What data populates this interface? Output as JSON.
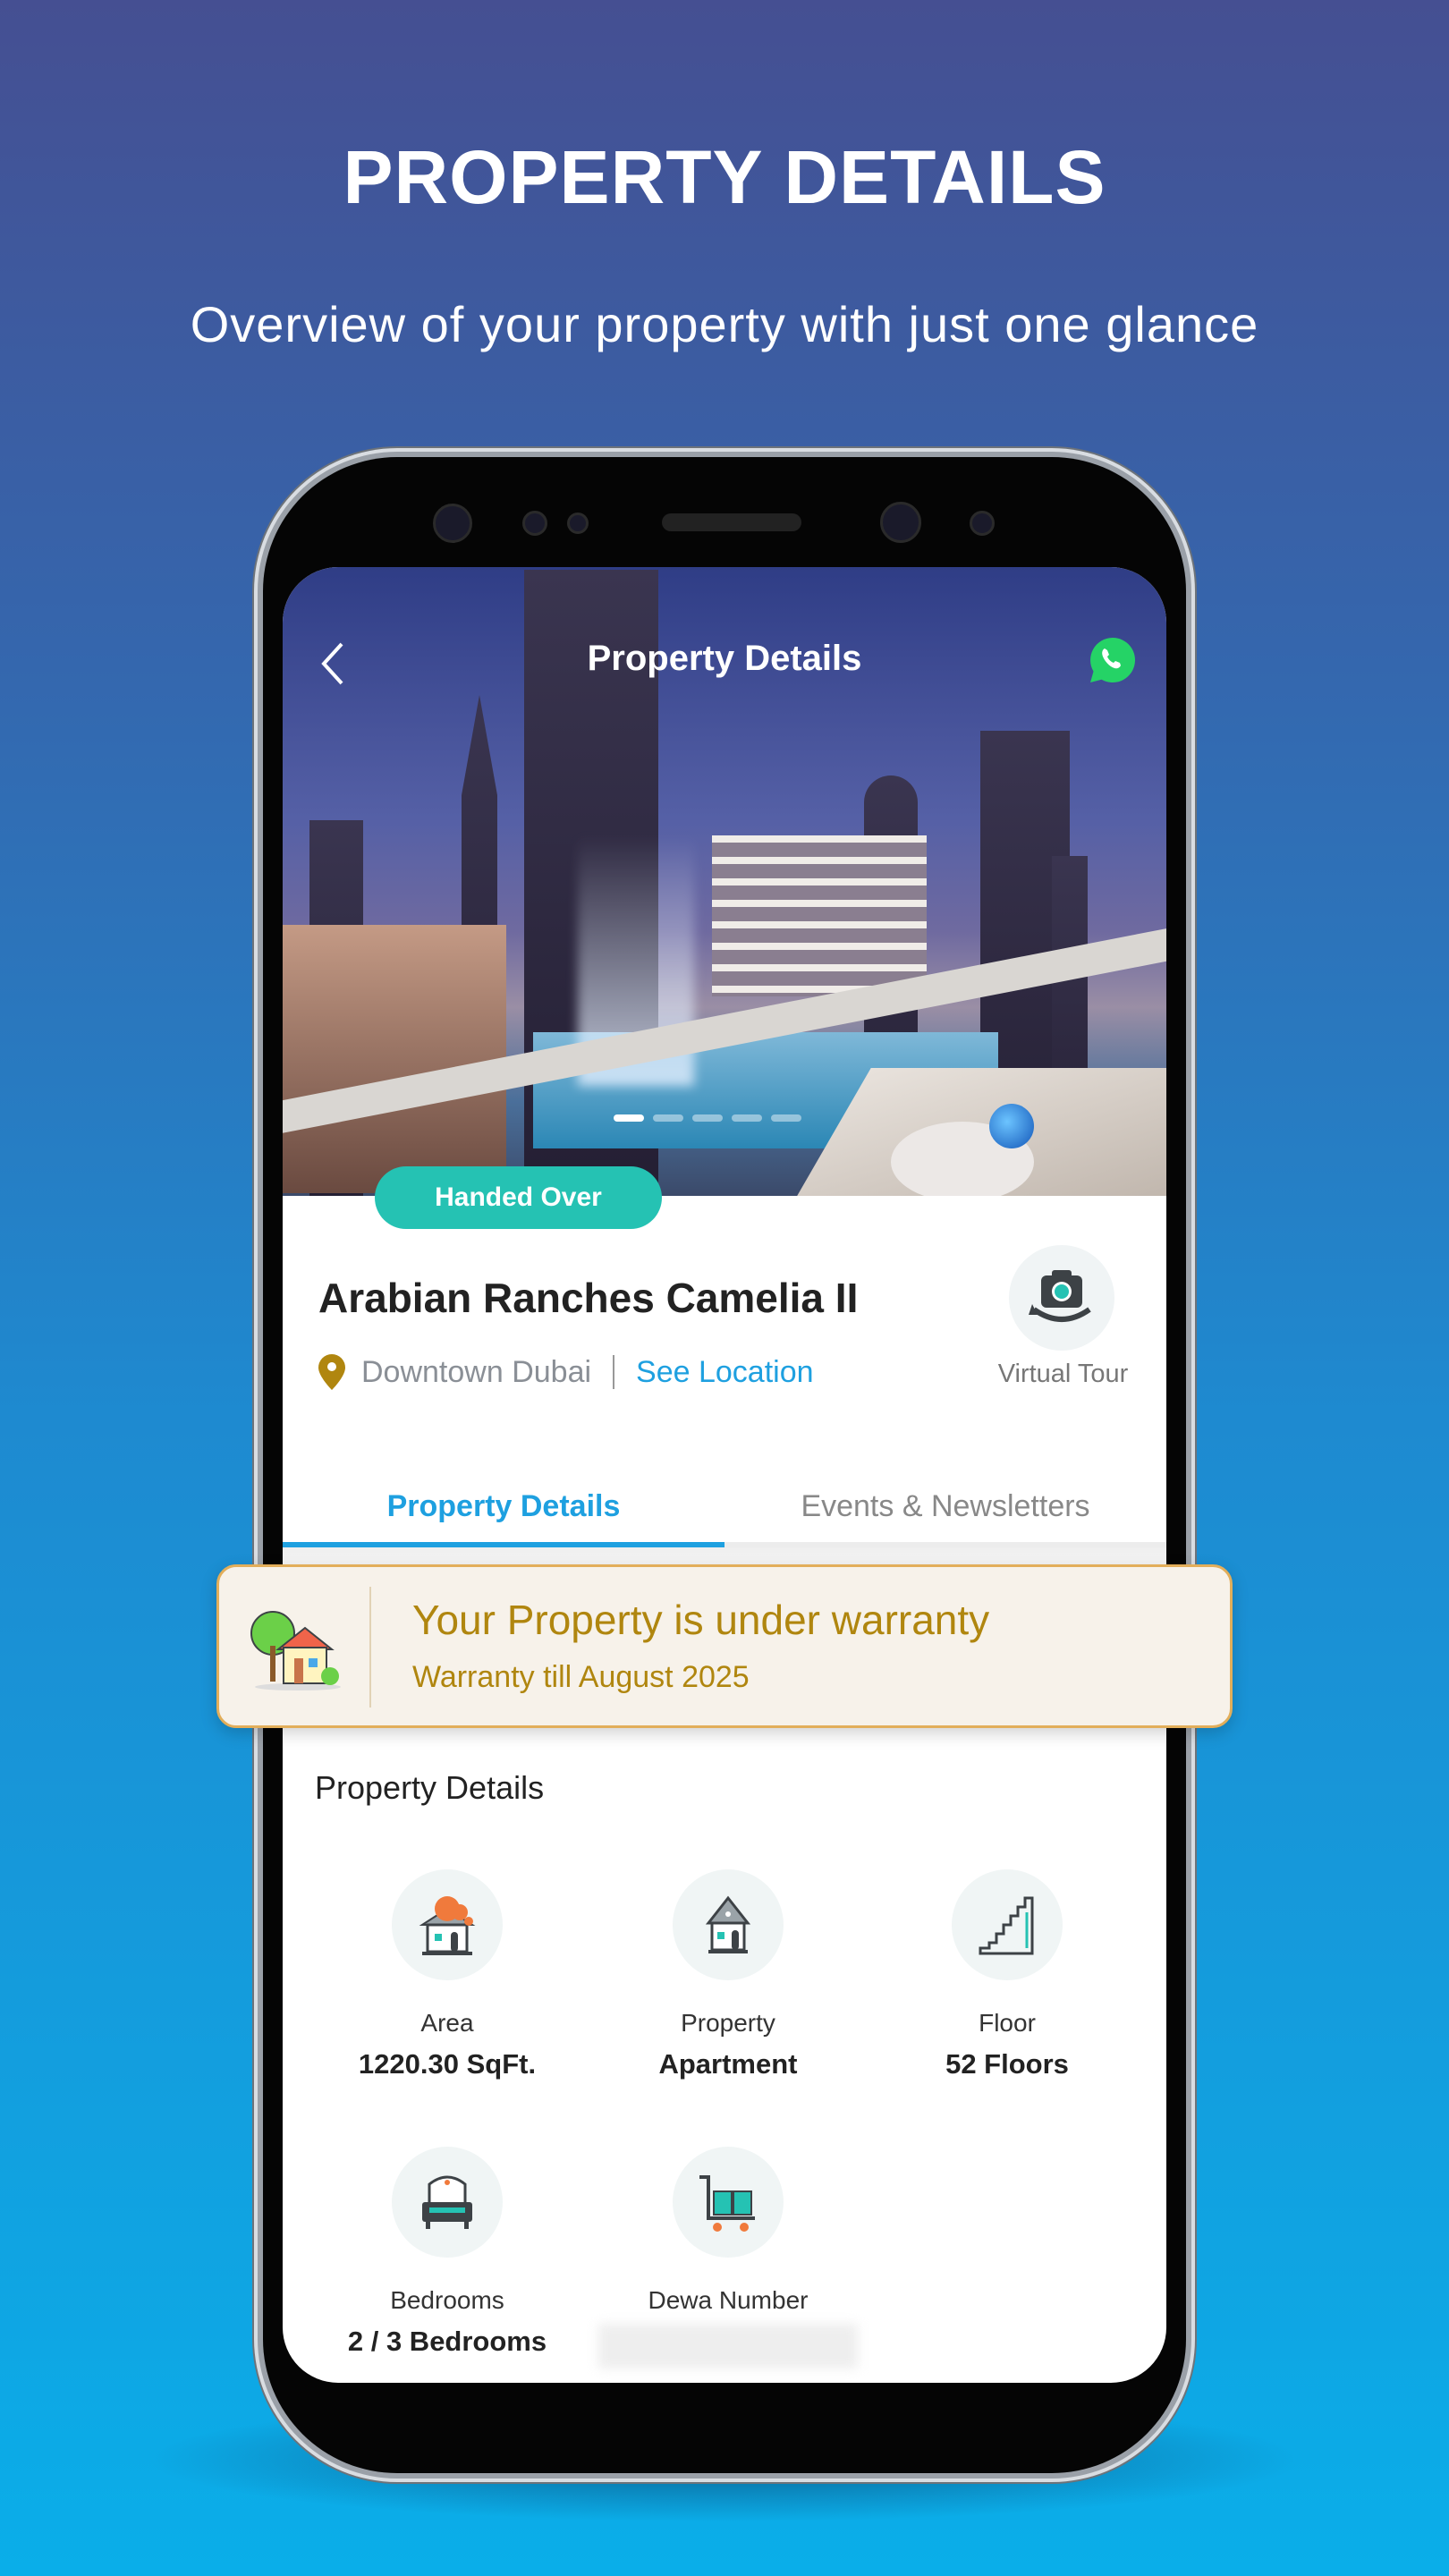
{
  "hero": {
    "title": "PROPERTY DETAILS",
    "subtitle": "Overview of your property with just one glance"
  },
  "app": {
    "header": {
      "title": "Property Details",
      "back_icon": "chevron-left-icon",
      "whatsapp_icon": "whatsapp-icon"
    },
    "carousel": {
      "slides": 5,
      "active": 0
    },
    "status_badge": "Handed Over",
    "property_name": "Arabian Ranches Camelia II",
    "location": "Downtown Dubai",
    "see_location": "See Location",
    "virtual_tour": "Virtual Tour",
    "tabs": [
      {
        "label": "Property Details",
        "active": true
      },
      {
        "label": "Events & Newsletters",
        "active": false
      }
    ],
    "warranty": {
      "title": "Your Property is under warranty",
      "subtitle": "Warranty till August 2025"
    },
    "section_title": "Property Details",
    "details": [
      {
        "label": "Area",
        "value": "1220.30 SqFt.",
        "icon": "house-area-icon"
      },
      {
        "label": "Property",
        "value": "Apartment",
        "icon": "house-icon"
      },
      {
        "label": "Floor",
        "value": "52 Floors",
        "icon": "stairs-icon"
      },
      {
        "label": "Bedrooms",
        "value": "2 / 3 Bedrooms",
        "icon": "sofa-icon"
      },
      {
        "label": "Dewa Number",
        "value": "",
        "icon": "cart-icon"
      }
    ],
    "colors": {
      "accent": "#1ea0e0",
      "badge": "#25c2b3",
      "warranty_text": "#b0860f",
      "warranty_border": "#e2ae5a"
    }
  }
}
